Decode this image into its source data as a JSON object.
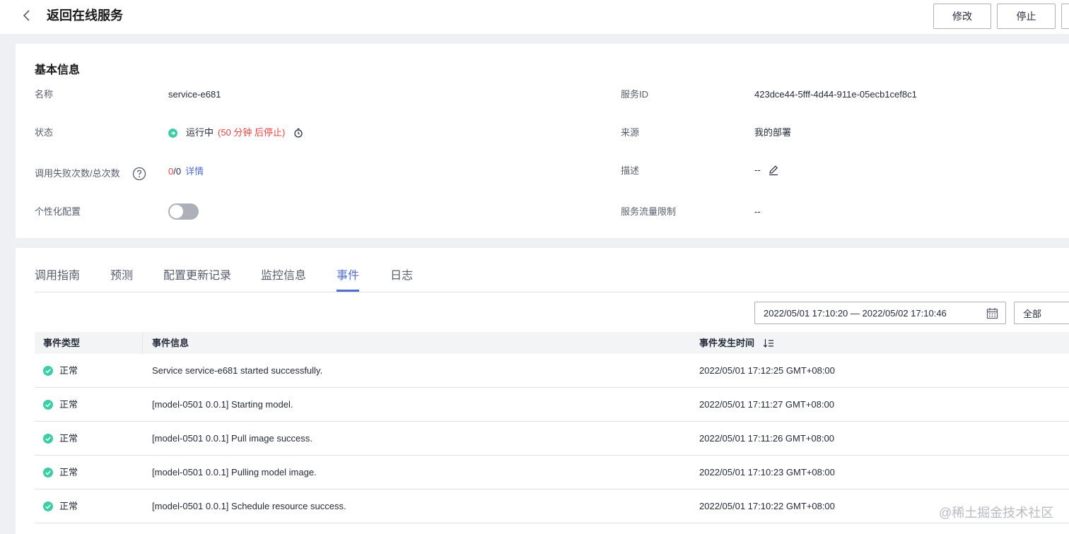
{
  "header": {
    "title": "返回在线服务",
    "buttons": {
      "modify": "修改",
      "stop": "停止"
    }
  },
  "basic_info": {
    "title": "基本信息",
    "name_label": "名称",
    "name_value": "service-e681",
    "service_id_label": "服务ID",
    "service_id_value": "423dce44-5fff-4d44-911e-05ecb1cef8c1",
    "status_label": "状态",
    "status_value": "运行中",
    "status_timer": "(50 分钟 后停止)",
    "source_label": "来源",
    "source_value": "我的部署",
    "calls_label": "调用失败次数/总次数",
    "calls_failed": "0",
    "calls_total": "/0",
    "calls_detail_link": "详情",
    "desc_label": "描述",
    "desc_value": "--",
    "personalize_label": "个性化配置",
    "personalize_enabled": false,
    "traffic_limit_label": "服务流量限制",
    "traffic_limit_value": "--"
  },
  "tabs": [
    {
      "label": "调用指南",
      "active": false
    },
    {
      "label": "预测",
      "active": false
    },
    {
      "label": "配置更新记录",
      "active": false
    },
    {
      "label": "监控信息",
      "active": false
    },
    {
      "label": "事件",
      "active": true
    },
    {
      "label": "日志",
      "active": false
    }
  ],
  "filters": {
    "date_range": "2022/05/01 17:10:20 — 2022/05/02 17:10:46",
    "type_select": "全部"
  },
  "events_table": {
    "columns": [
      "事件类型",
      "事件信息",
      "事件发生时间"
    ],
    "rows": [
      {
        "type": "正常",
        "info": "Service service-e681 started successfully.",
        "time": "2022/05/01 17:12:25 GMT+08:00"
      },
      {
        "type": "正常",
        "info": "[model-0501 0.0.1] Starting model.",
        "time": "2022/05/01 17:11:27 GMT+08:00"
      },
      {
        "type": "正常",
        "info": "[model-0501 0.0.1] Pull image success.",
        "time": "2022/05/01 17:11:26 GMT+08:00"
      },
      {
        "type": "正常",
        "info": "[model-0501 0.0.1] Pulling model image.",
        "time": "2022/05/01 17:10:23 GMT+08:00"
      },
      {
        "type": "正常",
        "info": "[model-0501 0.0.1] Schedule resource success.",
        "time": "2022/05/01 17:10:22 GMT+08:00"
      }
    ]
  },
  "watermark": "@稀土掘金技术社区",
  "colors": {
    "accent": "#526ecc",
    "success": "#3dcca6",
    "danger": "#e54545"
  }
}
